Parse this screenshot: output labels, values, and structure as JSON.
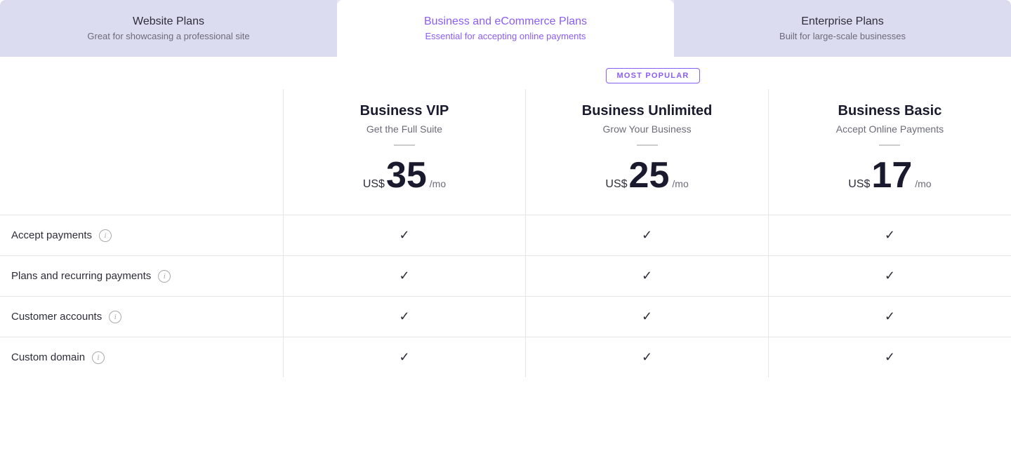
{
  "tabs": [
    {
      "id": "website",
      "title": "Website Plans",
      "subtitle": "Great for showcasing a professional site",
      "active": false
    },
    {
      "id": "business",
      "title": "Business and eCommerce Plans",
      "subtitle": "Essential for accepting online payments",
      "active": true
    },
    {
      "id": "enterprise",
      "title": "Enterprise Plans",
      "subtitle": "Built for large-scale businesses",
      "active": false
    }
  ],
  "most_popular_label": "MOST POPULAR",
  "plans": [
    {
      "id": "vip",
      "name": "Business VIP",
      "tagline": "Get the Full Suite",
      "currency": "US$",
      "price": "35",
      "period": "/mo"
    },
    {
      "id": "unlimited",
      "name": "Business Unlimited",
      "tagline": "Grow Your Business",
      "currency": "US$",
      "price": "25",
      "period": "/mo"
    },
    {
      "id": "basic",
      "name": "Business Basic",
      "tagline": "Accept Online Payments",
      "currency": "US$",
      "price": "17",
      "period": "/mo"
    }
  ],
  "features": [
    {
      "id": "accept-payments",
      "name": "Accept payments",
      "vip": true,
      "unlimited": true,
      "basic": true
    },
    {
      "id": "plans-recurring",
      "name": "Plans and recurring payments",
      "vip": true,
      "unlimited": true,
      "basic": true
    },
    {
      "id": "customer-accounts",
      "name": "Customer accounts",
      "vip": true,
      "unlimited": true,
      "basic": true
    },
    {
      "id": "custom-domain",
      "name": "Custom domain",
      "vip": true,
      "unlimited": true,
      "basic": true
    }
  ]
}
